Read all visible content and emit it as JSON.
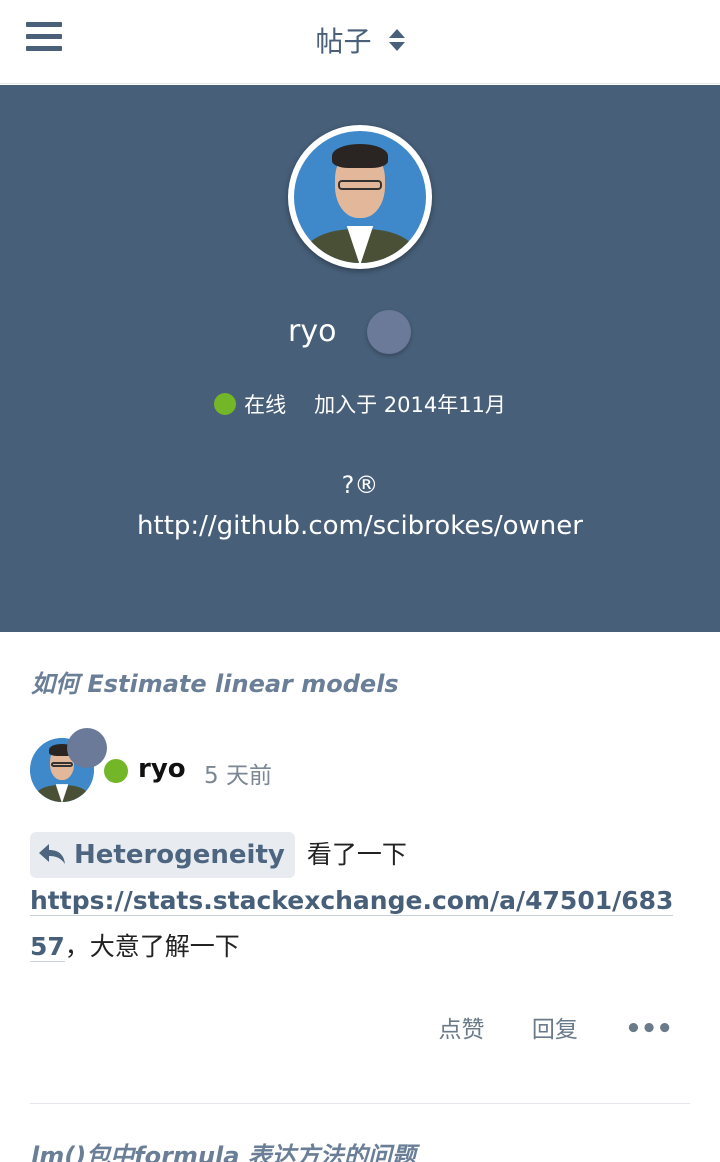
{
  "header": {
    "title": "帖子"
  },
  "profile": {
    "username": "ryo",
    "status_label": "在线",
    "joined": "加入于 2014年11月",
    "bio_line1": "?®",
    "bio_line2": "http://github.com/scibrokes/owner"
  },
  "post": {
    "topic_title": "如何 Estimate linear models",
    "author": "ryo",
    "time": "5 天前",
    "reply_to": "Heterogeneity",
    "text_before_link": "看了一下",
    "link": "https://stats.stackexchange.com/a/47501/68357",
    "text_after_link": "，大意了解一下",
    "actions": {
      "like": "点赞",
      "reply": "回复",
      "more": "•••"
    }
  },
  "next_post": {
    "topic_title": "lm()包中formula 表达方法的问题"
  },
  "colors": {
    "cover_bg": "#475f79",
    "online": "#73b627",
    "accent": "#4a5f78"
  }
}
